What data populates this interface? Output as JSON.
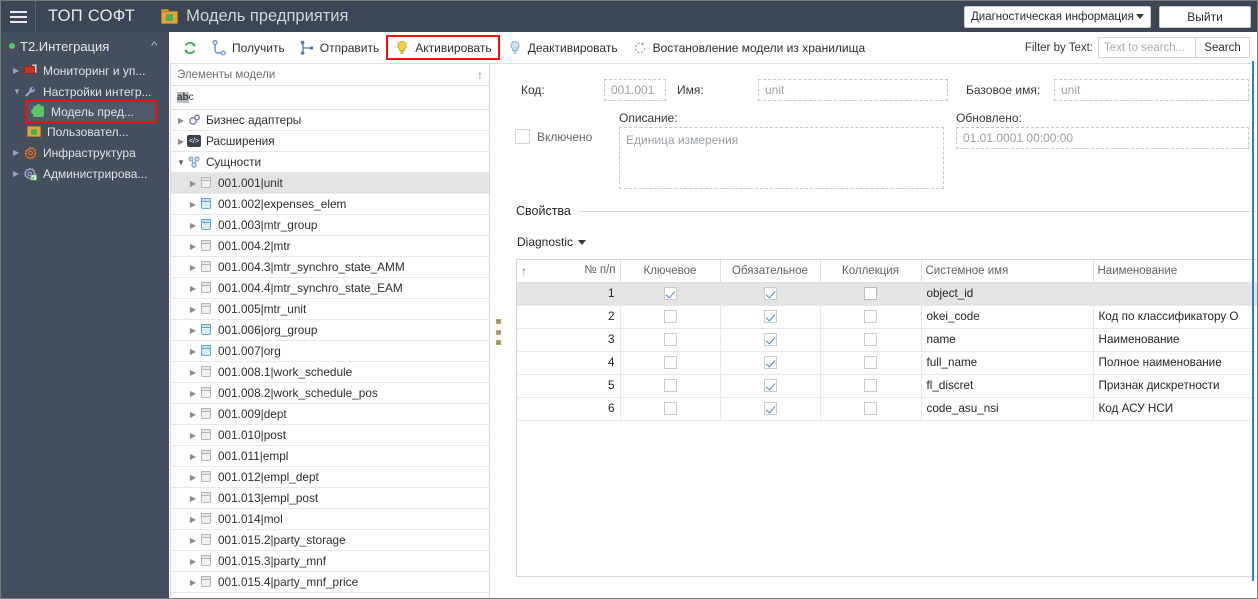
{
  "header": {
    "menu_icon": "hamburger-icon",
    "brand": "ТОП СОФТ",
    "page_icon": "folder-puzzle-icon",
    "page_title": "Модель предприятия",
    "diagnostic_select": "Диагностическая информация",
    "logout_label": "Выйти"
  },
  "sidebar": {
    "section": {
      "label": "T2.Интеграция",
      "status_color": "#5ec46b"
    },
    "items": [
      {
        "label": "Мониторинг и уп...",
        "icon": "monitor-icon",
        "arrow": "collapsed",
        "indent": 0,
        "highlighted": false
      },
      {
        "label": "Настройки интегр...",
        "icon": "wrench-icon",
        "arrow": "expanded",
        "indent": 0,
        "highlighted": false
      },
      {
        "label": "Модель пред...",
        "icon": "green-puzzle-icon",
        "arrow": "none",
        "indent": 1,
        "highlighted": true
      },
      {
        "label": "Пользовател...",
        "icon": "folder-puzzle-icon",
        "arrow": "none",
        "indent": 1,
        "highlighted": false
      },
      {
        "label": "Инфраструктура",
        "icon": "orange-gear-icon",
        "arrow": "collapsed",
        "indent": 0,
        "highlighted": false
      },
      {
        "label": "Администрирова...",
        "icon": "purple-gear-icon",
        "arrow": "collapsed",
        "indent": 0,
        "highlighted": false
      }
    ]
  },
  "toolbar": {
    "refresh_icon": "refresh-icon",
    "buttons": [
      {
        "label": "Получить",
        "icon": "download-node-icon",
        "highlighted": false
      },
      {
        "label": "Отправить",
        "icon": "upload-node-icon",
        "highlighted": false
      },
      {
        "label": "Активировать",
        "icon": "bulb-on-icon",
        "highlighted": true
      },
      {
        "label": "Деактивировать",
        "icon": "bulb-off-icon",
        "highlighted": false
      },
      {
        "label": "Востановление модели из хранилища",
        "icon": "restore-icon",
        "highlighted": false
      }
    ],
    "filter_label": "Filter by Text:",
    "filter_placeholder": "Text to search...",
    "filter_value": "",
    "search_label": "Search"
  },
  "tree": {
    "header": "Элементы модели",
    "sort_icon": "sort-asc-icon",
    "filter_icon": "abc-icon",
    "filter_value": "",
    "nodes": [
      {
        "label": "Бизнес адаптеры",
        "icon": "gears-icon",
        "arrow": "collapsed",
        "level": 1,
        "selected": false
      },
      {
        "label": "Расширения",
        "icon": "code-icon",
        "arrow": "collapsed",
        "level": 1,
        "selected": false
      },
      {
        "label": "Сущности",
        "icon": "entities-icon",
        "arrow": "expanded",
        "level": 1,
        "selected": false
      },
      {
        "label": "001.001|unit",
        "icon": "cube-gray-icon",
        "arrow": "collapsed",
        "level": 2,
        "selected": true
      },
      {
        "label": "001.002|expenses_elem",
        "icon": "cube-blue-icon",
        "arrow": "collapsed",
        "level": 2,
        "selected": false
      },
      {
        "label": "001.003|mtr_group",
        "icon": "cube-blue-icon",
        "arrow": "collapsed",
        "level": 2,
        "selected": false
      },
      {
        "label": "001.004.2|mtr",
        "icon": "cube-gray-icon",
        "arrow": "collapsed",
        "level": 2,
        "selected": false
      },
      {
        "label": "001.004.3|mtr_synchro_state_AMM",
        "icon": "cube-gray-icon",
        "arrow": "collapsed",
        "level": 2,
        "selected": false
      },
      {
        "label": "001.004.4|mtr_synchro_state_EAM",
        "icon": "cube-gray-icon",
        "arrow": "collapsed",
        "level": 2,
        "selected": false
      },
      {
        "label": "001.005|mtr_unit",
        "icon": "cube-gray-icon",
        "arrow": "collapsed",
        "level": 2,
        "selected": false
      },
      {
        "label": "001.006|org_group",
        "icon": "cube-blue-icon",
        "arrow": "collapsed",
        "level": 2,
        "selected": false
      },
      {
        "label": "001.007|org",
        "icon": "cube-blue-icon",
        "arrow": "collapsed",
        "level": 2,
        "selected": false
      },
      {
        "label": "001.008.1|work_schedule",
        "icon": "cube-gray-icon",
        "arrow": "collapsed",
        "level": 2,
        "selected": false
      },
      {
        "label": "001.008.2|work_schedule_pos",
        "icon": "cube-gray-icon",
        "arrow": "collapsed",
        "level": 2,
        "selected": false
      },
      {
        "label": "001.009|dept",
        "icon": "cube-gray-icon",
        "arrow": "collapsed",
        "level": 2,
        "selected": false
      },
      {
        "label": "001.010|post",
        "icon": "cube-gray-icon",
        "arrow": "collapsed",
        "level": 2,
        "selected": false
      },
      {
        "label": "001.011|empl",
        "icon": "cube-gray-icon",
        "arrow": "collapsed",
        "level": 2,
        "selected": false
      },
      {
        "label": "001.012|empl_dept",
        "icon": "cube-gray-icon",
        "arrow": "collapsed",
        "level": 2,
        "selected": false
      },
      {
        "label": "001.013|empl_post",
        "icon": "cube-gray-icon",
        "arrow": "collapsed",
        "level": 2,
        "selected": false
      },
      {
        "label": "001.014|mol",
        "icon": "cube-gray-icon",
        "arrow": "collapsed",
        "level": 2,
        "selected": false
      },
      {
        "label": "001.015.2|party_storage",
        "icon": "cube-gray-icon",
        "arrow": "collapsed",
        "level": 2,
        "selected": false
      },
      {
        "label": "001.015.3|party_mnf",
        "icon": "cube-gray-icon",
        "arrow": "collapsed",
        "level": 2,
        "selected": false
      },
      {
        "label": "001.015.4|party_mnf_price",
        "icon": "cube-gray-icon",
        "arrow": "collapsed",
        "level": 2,
        "selected": false
      }
    ]
  },
  "form": {
    "code_label": "Код:",
    "code_value": "001.001",
    "name_label": "Имя:",
    "name_value": "unit",
    "base_name_label": "Базовое имя:",
    "base_name_value": "unit",
    "enabled_label": "Включено",
    "enabled_checked": false,
    "description_label": "Описание:",
    "description_value": "Единица измерения",
    "updated_label": "Обновлено:",
    "updated_value": "01.01.0001 00:00:00"
  },
  "properties": {
    "section_title": "Свойства",
    "view_dropdown": "Diagnostic",
    "columns": [
      "",
      "№ п/п",
      "Ключевое",
      "Обязательное",
      "Коллекция",
      "Системное имя",
      "Наименование"
    ],
    "rows": [
      {
        "n": "1",
        "key": true,
        "required": true,
        "collection": false,
        "collection_white": true,
        "system_name": "object_id",
        "title": "",
        "selected": true
      },
      {
        "n": "2",
        "key": false,
        "required": true,
        "collection": false,
        "collection_white": false,
        "system_name": "okei_code",
        "title": "Код по классификатору О",
        "selected": false
      },
      {
        "n": "3",
        "key": false,
        "required": true,
        "collection": false,
        "collection_white": false,
        "system_name": "name",
        "title": "Наименование",
        "selected": false
      },
      {
        "n": "4",
        "key": false,
        "required": true,
        "collection": false,
        "collection_white": false,
        "system_name": "full_name",
        "title": "Полное наименование",
        "selected": false
      },
      {
        "n": "5",
        "key": false,
        "required": true,
        "collection": false,
        "collection_white": false,
        "system_name": "fl_discret",
        "title": "Признак дискретности",
        "selected": false
      },
      {
        "n": "6",
        "key": false,
        "required": true,
        "collection": false,
        "collection_white": false,
        "system_name": "code_asu_nsi",
        "title": "Код АСУ НСИ",
        "selected": false
      }
    ]
  },
  "colors": {
    "header_bg": "#3d4654",
    "sidebar_bg": "#454e5d",
    "highlight_red": "#ee1111",
    "accent_blue": "#4a86c8",
    "status_green": "#5ec46b"
  }
}
